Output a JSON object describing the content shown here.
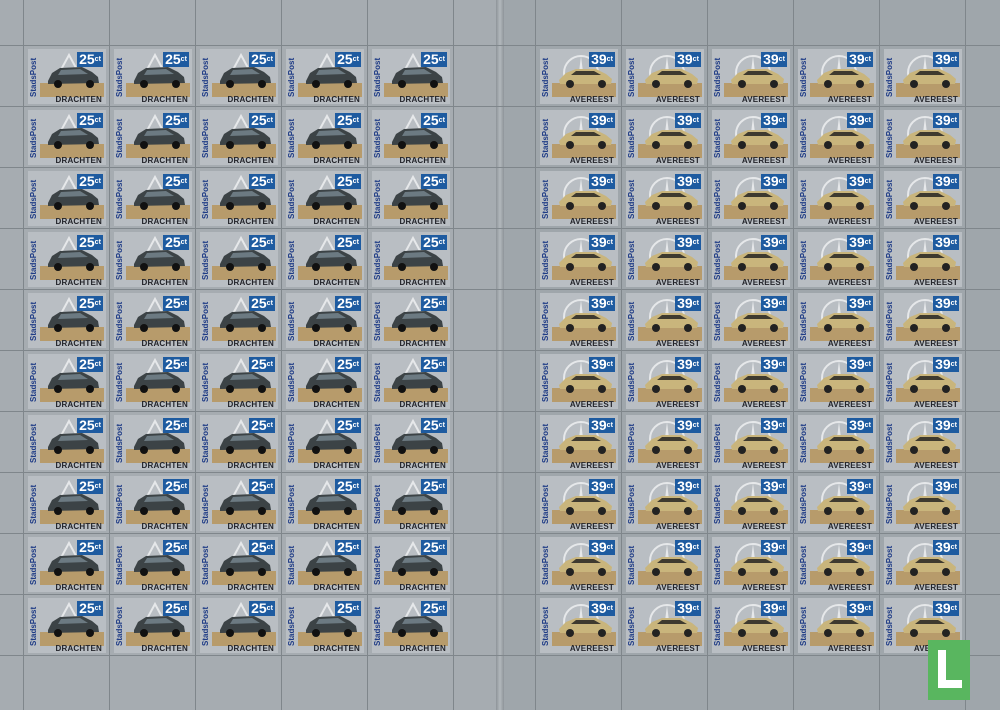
{
  "left_pane": {
    "brand": "StadsPost",
    "value": "25",
    "value_suffix": "ct",
    "place": "DRACHTEN",
    "car_color": "#3c4346",
    "emblem": "triangle-emblem-icon"
  },
  "right_pane": {
    "brand": "StadsPost",
    "value": "39",
    "value_suffix": "ct",
    "place": "AVEREEST",
    "car_color": "#c9b57c",
    "emblem": "star-emblem-icon"
  },
  "grid": {
    "rows": 10,
    "columns_per_pane": 5
  },
  "colors": {
    "sheet": "#a6acb1",
    "value_box": "#1e5ba0",
    "brand_text": "#1f3c86",
    "logo": "#59b65f"
  },
  "watermark_logo": "L-logo-icon"
}
